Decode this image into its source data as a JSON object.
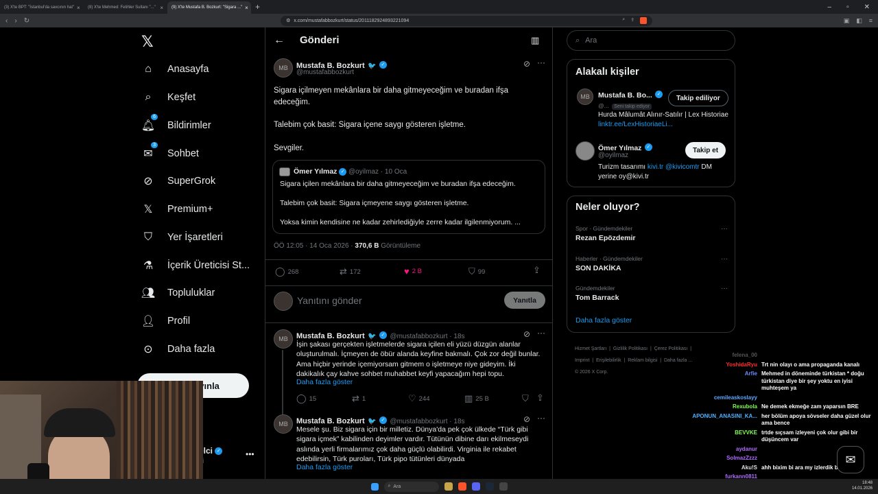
{
  "browser": {
    "tabs": [
      {
        "label": "(3) X'te BPT: \"İstanbul'da savcının hal\"",
        "active": false
      },
      {
        "label": "(8) X'te Mehmed: Fetihler Sultanı \"...\"",
        "active": false
      },
      {
        "label": "(9) X'te Mustafa B. Bozkurt: \"Sigara ...\"",
        "active": true
      }
    ],
    "url": "x.com/mustafabbozkurt/status/2011182924893221094"
  },
  "nav": {
    "items": [
      {
        "label": "Anasayfa",
        "icon": "home-icon"
      },
      {
        "label": "Keşfet",
        "icon": "search-icon"
      },
      {
        "label": "Bildirimler",
        "icon": "bell-icon",
        "badge": "6"
      },
      {
        "label": "Sohbet",
        "icon": "mail-icon",
        "badge": "3"
      },
      {
        "label": "SuperGrok",
        "icon": "grok-icon"
      },
      {
        "label": "Premium+",
        "icon": "x-icon"
      },
      {
        "label": "Yer İşaretleri",
        "icon": "bookmark-icon"
      },
      {
        "label": "İçerik Üreticisi St...",
        "icon": "flask-icon"
      },
      {
        "label": "Topluluklar",
        "icon": "people-icon"
      },
      {
        "label": "Profil",
        "icon": "person-icon"
      },
      {
        "label": "Daha fazla",
        "icon": "more-circle-icon"
      }
    ],
    "post_button": "ayınla",
    "account_name": "elci",
    "account_handle": "xi"
  },
  "header": {
    "title": "Gönderi"
  },
  "tweet": {
    "name": "Mustafa B. Bozkurt",
    "handle": "@mustafabbozkurt",
    "p1": "Sigara içilmeyen mekânlara bir daha gitmeyeceğim ve buradan ifşa edeceğim.",
    "p2": "Talebim çok basit: Sigara içene saygı gösteren işletme.",
    "p3": "Sevgiler.",
    "quote": {
      "name": "Ömer Yılmaz",
      "handle": "@oyilmaz",
      "date": "· 10 Oca",
      "l1": "Sigara içilen mekânlara bir daha gitmeyeceğim ve buradan ifşa edeceğim.",
      "l2": "Talebim çok basit: Sigara içmeyene saygı gösteren işletme.",
      "l3": "Yoksa kimin kendisine ne kadar zehirlediğiyle zerre kadar ilgilenmiyorum. ..."
    },
    "time": "ÖÖ 12:05 · 14 Oca 2026 ·",
    "views_value": "370,6 B",
    "views_label": "Görüntüleme",
    "replies": "268",
    "retweets": "172",
    "likes": "2 B",
    "bookmarks": "99"
  },
  "reply_box": {
    "placeholder": "Yanıtını gönder",
    "button": "Yanıtla"
  },
  "replies": [
    {
      "name": "Mustafa B. Bozkurt",
      "handle": "@mustafabbozkurt · 18s",
      "text": "İşin şakası gerçekten işletmelerde sigara içilen eli yüzü düzgün alanlar oluşturulmalı. İçmeyen de öbür alanda keyfine bakmalı. Çok zor değil bunlar. Ama hiçbir yerinde içemiyorsam gitmem o işletmeye niye gideyim. İki dakikalık çay kahve sohbet muhabbet keyfi yapacağım hepi topu.",
      "more": "Daha fazla göster",
      "replies": "15",
      "retweets": "1",
      "likes": "244",
      "views": "25 B"
    },
    {
      "name": "Mustafa B. Bozkurt",
      "handle": "@mustafabbozkurt · 18s",
      "text": "Mesele şu. Biz sigara için bir milletiz. Dünya'da pek çok ülkede “Türk gibi sigara içmek” kabilinden deyimler vardır. Tütünün dibine darı ekilmeseydi aslında yerli firmalarımız çok daha güçlü olabilirdi. Virginia ile rekabet edebilirsin, Türk puroları, Türk pipo tütünleri dünyada",
      "more": "Daha fazla göster"
    }
  ],
  "search": {
    "placeholder": "Ara"
  },
  "related": {
    "title": "Alakalı kişiler",
    "people": [
      {
        "name": "Mustafa B. Bo...",
        "handle": "@...",
        "follows_you": "Seni takip ediyor",
        "button": "Takip ediliyor",
        "bio": "Hurda Mâlumât Alınır-Satılır | Lex Historiae ",
        "bio_link": "linktr.ee/LexHistoriaeLi..."
      },
      {
        "name": "Ömer Yılmaz",
        "handle": "@oyilmaz",
        "button": "Takip et",
        "bio_a": "Turizm tasarımı ",
        "bio_link1": "kivi.tr",
        "bio_link2": " @kivicomtr",
        "bio_b": " DM yerine oy@kivi.tr"
      }
    ]
  },
  "trends": {
    "title": "Neler oluyor?",
    "items": [
      {
        "category": "Spor · Gündemdekiler",
        "topic": "Rezan Epözdemir"
      },
      {
        "category": "Haberler · Gündemdekiler",
        "topic": "SON DAKİKA"
      },
      {
        "category": "Gündemdekiler",
        "topic": "Tom Barrack"
      }
    ],
    "more": "Daha fazla göster"
  },
  "footer": {
    "links": [
      "Hizmet Şartları",
      "Gizlilik Politikası",
      "Çerez Politikası",
      "Imprint",
      "Erişilebilirlik",
      "Reklam bilgisi",
      "Daha fazla ..."
    ],
    "copyright": "© 2026 X Corp."
  },
  "chat": [
    {
      "user": "felena_00",
      "msg": "",
      "color": "#555555"
    },
    {
      "user": "YoshidaRyu",
      "msg": "Trt nin olayı o ama propaganda kanalı",
      "color": "#ff2d2d"
    },
    {
      "user": "Arfie",
      "msg": "Mehmed in döneminde türkistan * doğu türkistan diye bir şey yoktu en iyisi muhteşem ya",
      "color": "#6b8cff"
    },
    {
      "user": "cemileaskoslayy",
      "msg": "",
      "color": "#5fa8ff"
    },
    {
      "user": "Rexubola",
      "msg": "Ne demek ekmeğe zam yaparsın BRE",
      "color": "#7dff4d"
    },
    {
      "user": "APONUN_ANASINI_KA...",
      "msg": "her bölüm apoya sövseler daha güzel olur ama bence",
      "color": "#4db0ff"
    },
    {
      "user": "BEVVKE",
      "msg": "trtde sıçsam izleyeni çok olur gibi bir düşüncem var",
      "color": "#7dff4d"
    },
    {
      "user": "aydanur",
      "msg": "",
      "color": "#b06bff"
    },
    {
      "user": "SolmazZzzz",
      "msg": "",
      "color": "#b06bff"
    },
    {
      "user": "Aku!S",
      "msg": "ahh bixim bi ara my izlerdik beraber",
      "color": "#e0e0e0"
    },
    {
      "user": "furkann0811",
      "msg": "",
      "color": "#b06bff"
    }
  ],
  "taskbar": {
    "search": "Ara",
    "time": "18:48",
    "date": "14.01.2026"
  }
}
